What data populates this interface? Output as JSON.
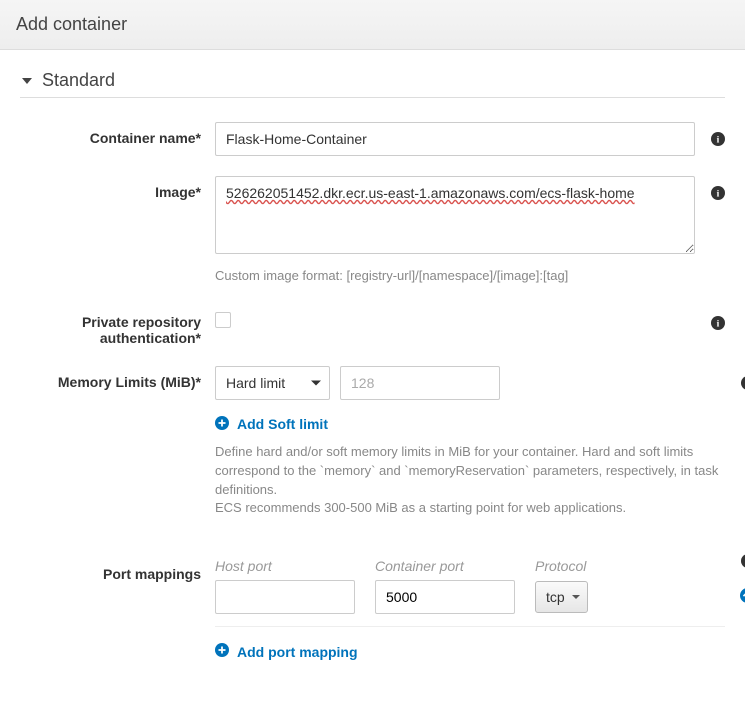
{
  "header": {
    "title": "Add container"
  },
  "section": {
    "title": "Standard"
  },
  "containerName": {
    "label": "Container name*",
    "value": "Flask-Home-Container"
  },
  "image": {
    "label": "Image*",
    "value": "526262051452.dkr.ecr.us-east-1.amazonaws.com/ecs-flask-home",
    "help": "Custom image format: [registry-url]/[namespace]/[image]:[tag]"
  },
  "privateRepo": {
    "label": "Private repository authentication*",
    "checked": false
  },
  "memory": {
    "label": "Memory Limits (MiB)*",
    "selected": "Hard limit",
    "placeholder": "128",
    "value": "",
    "addSoftLabel": "Add Soft limit",
    "help": "Define hard and/or soft memory limits in MiB for your container. Hard and soft limits correspond to the `memory` and `memoryReservation` parameters, respectively, in task definitions.\nECS recommends 300-500 MiB as a starting point for web applications."
  },
  "portMappings": {
    "label": "Port mappings",
    "columns": {
      "host": "Host port",
      "container": "Container port",
      "protocol": "Protocol"
    },
    "rows": [
      {
        "host": "",
        "container": "5000",
        "protocol": "tcp"
      }
    ],
    "addLabel": "Add port mapping"
  }
}
